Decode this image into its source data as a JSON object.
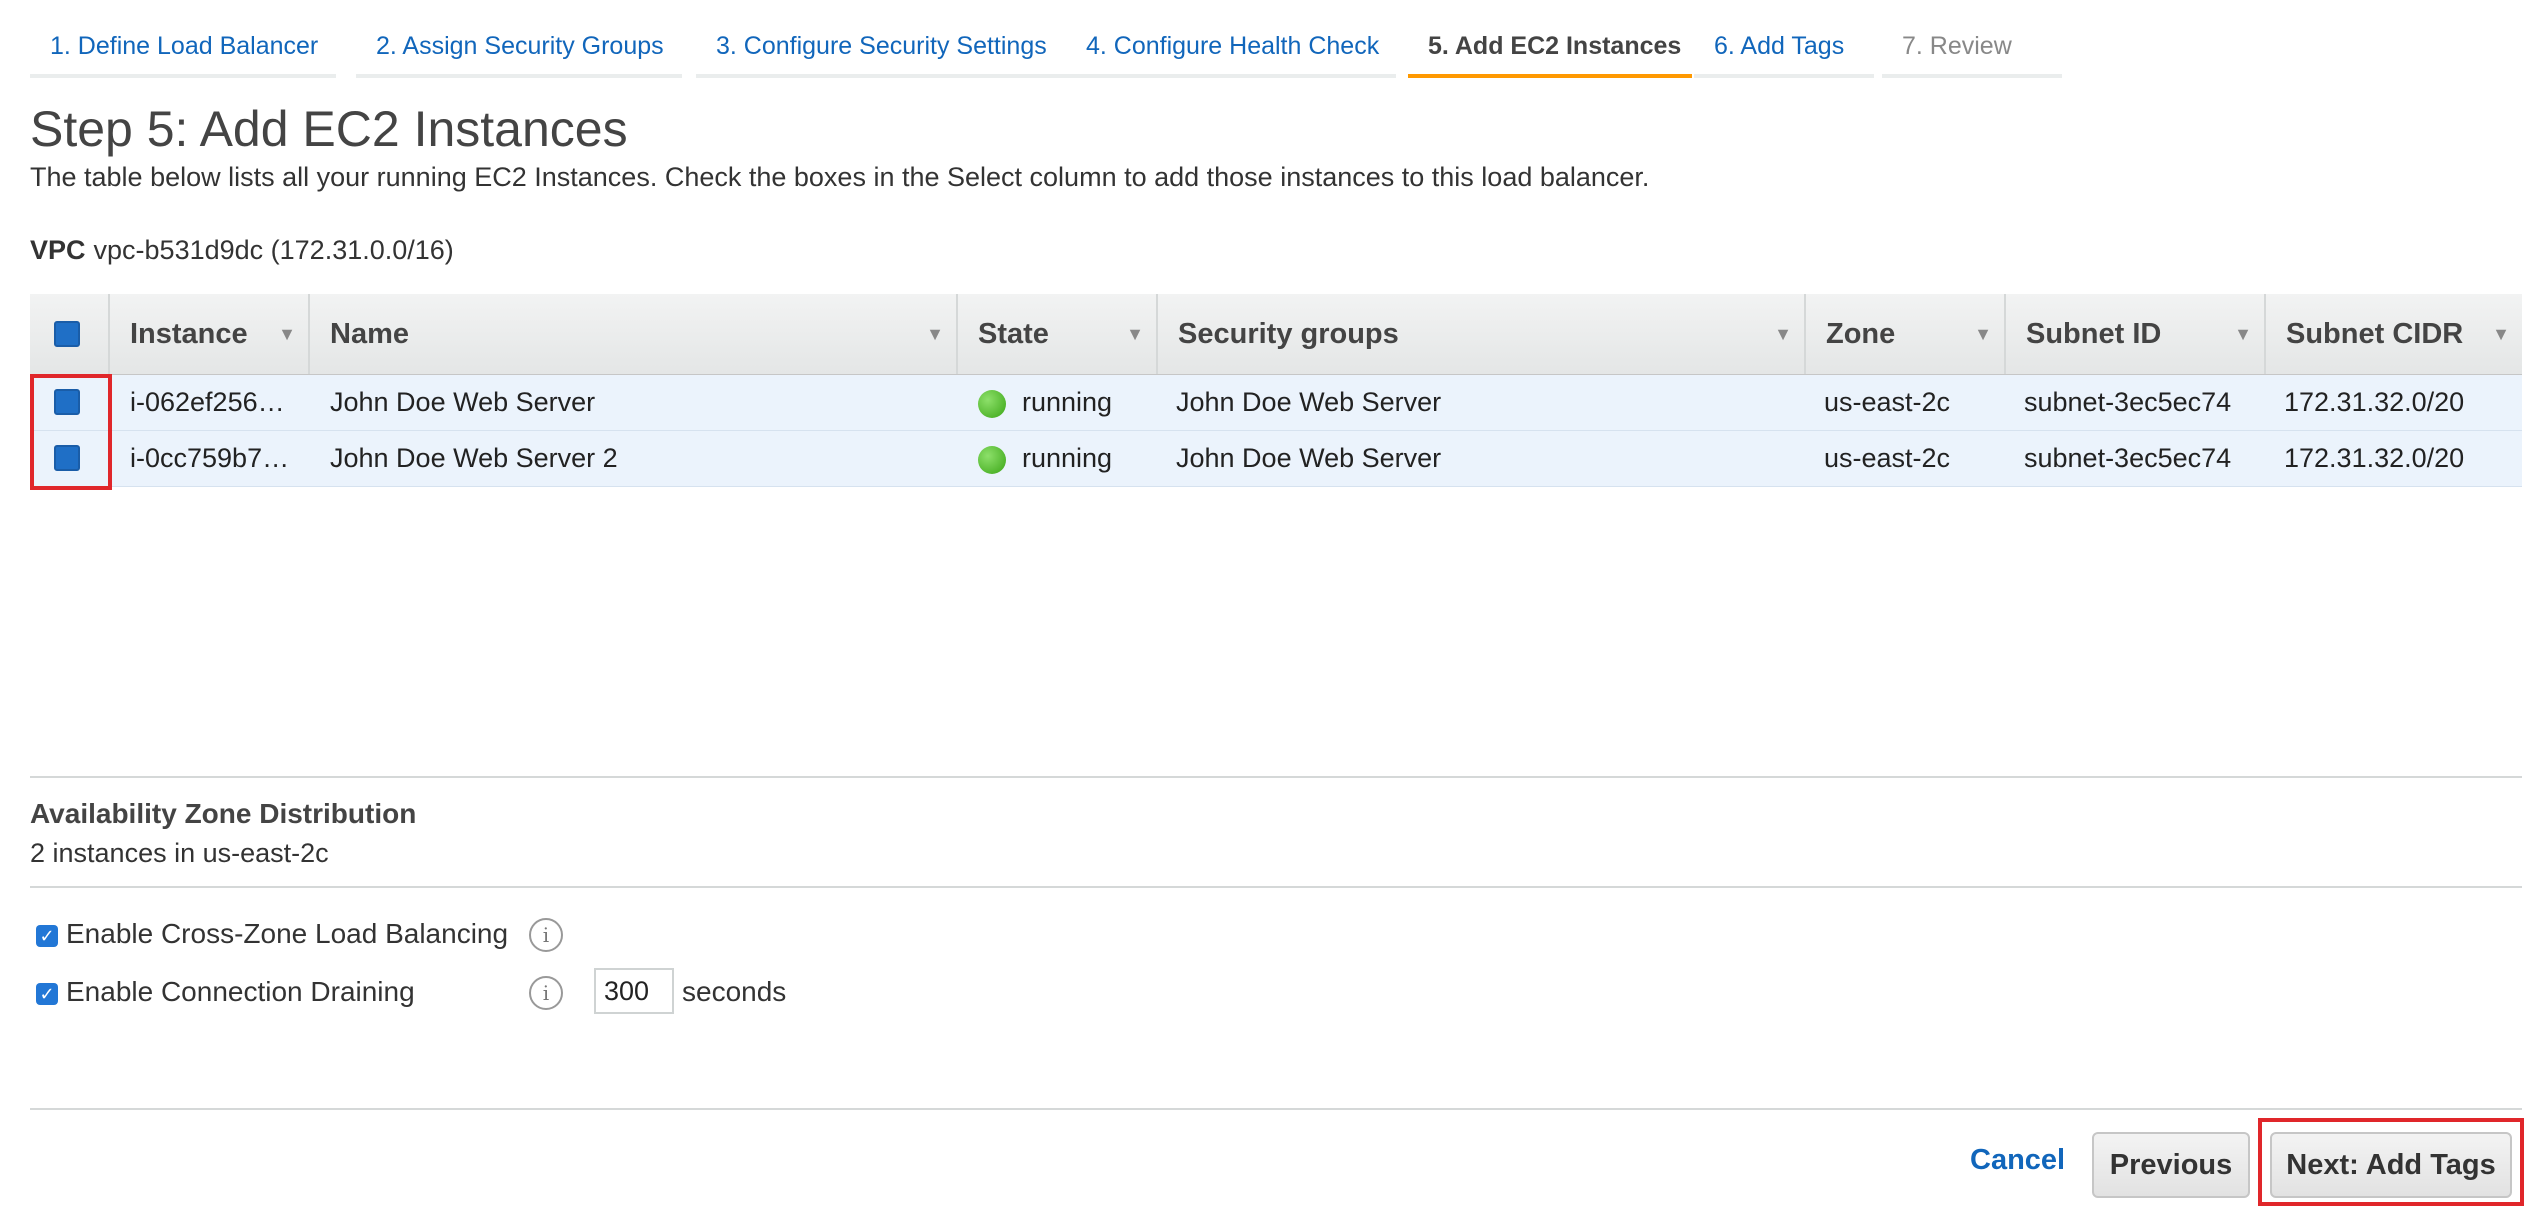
{
  "wizard": {
    "tabs": [
      {
        "label": "1. Define Load Balancer"
      },
      {
        "label": "2. Assign Security Groups"
      },
      {
        "label": "3. Configure Security Settings"
      },
      {
        "label": "4. Configure Health Check"
      },
      {
        "label": "5. Add EC2 Instances"
      },
      {
        "label": "6. Add Tags"
      },
      {
        "label": "7. Review"
      }
    ],
    "active_tab": "5. Add EC2 Instances"
  },
  "page": {
    "title": "Step 5: Add EC2 Instances",
    "description": "The table below lists all your running EC2 Instances. Check the boxes in the Select column to add those instances to this load balancer.",
    "vpc_label": "VPC",
    "vpc_value": "vpc-b531d9dc (172.31.0.0/16)"
  },
  "table": {
    "columns": [
      "Instance",
      "Name",
      "State",
      "Security groups",
      "Zone",
      "Subnet ID",
      "Subnet CIDR"
    ],
    "rows": [
      {
        "instance": "i-062ef256…",
        "name": "John Doe Web Server",
        "state": "running",
        "security_groups": "John Doe Web Server",
        "zone": "us-east-2c",
        "subnet_id": "subnet-3ec5ec74",
        "subnet_cidr": "172.31.32.0/20",
        "selected": true
      },
      {
        "instance": "i-0cc759b7…",
        "name": "John Doe Web Server 2",
        "state": "running",
        "security_groups": "John Doe Web Server",
        "zone": "us-east-2c",
        "subnet_id": "subnet-3ec5ec74",
        "subnet_cidr": "172.31.32.0/20",
        "selected": true
      }
    ]
  },
  "availability": {
    "title": "Availability Zone Distribution",
    "text": "2 instances in us-east-2c"
  },
  "options": {
    "cross_zone_label": "Enable Cross-Zone Load Balancing",
    "cross_zone_checked": true,
    "draining_label": "Enable Connection Draining",
    "draining_checked": true,
    "draining_timeout": "300",
    "draining_unit": "seconds"
  },
  "footer": {
    "cancel_label": "Cancel",
    "previous_label": "Previous",
    "next_label": "Next: Add Tags"
  },
  "colors": {
    "accent_tab": "#ff9900",
    "link": "#1166bb",
    "selected_row": "#ebf3fc",
    "highlight": "#e0262a",
    "running": "#3aa516"
  }
}
